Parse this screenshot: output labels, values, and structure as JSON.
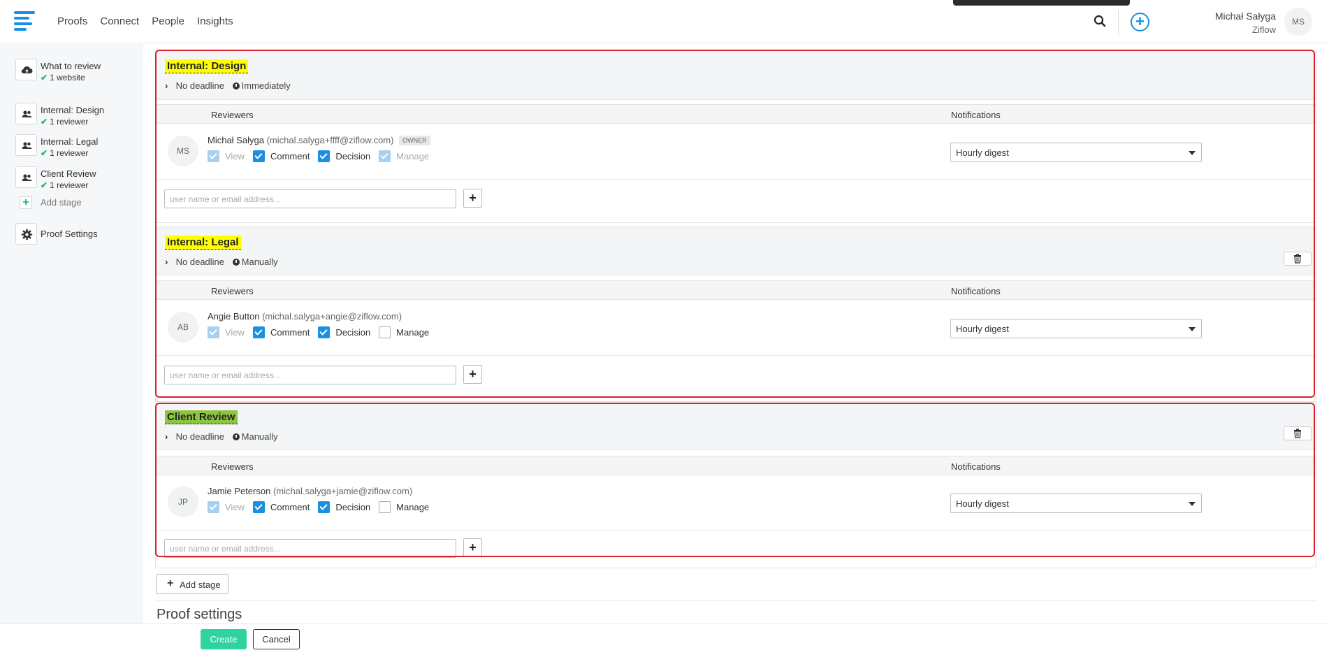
{
  "nav": {
    "items": [
      "Proofs",
      "Connect",
      "People",
      "Insights"
    ]
  },
  "user": {
    "name": "Michał Sałyga",
    "org": "Ziflow",
    "initials": "MS"
  },
  "sidebar": {
    "items": [
      {
        "title": "What to review",
        "sub": "1 website",
        "icon": "cloud-upload-icon"
      },
      {
        "title": "Internal: Design",
        "sub": "1 reviewer",
        "icon": "people-icon"
      },
      {
        "title": "Internal: Legal",
        "sub": "1 reviewer",
        "icon": "people-icon"
      },
      {
        "title": "Client Review",
        "sub": "1 reviewer",
        "icon": "people-icon"
      }
    ],
    "add_stage": "Add stage",
    "proof_settings": "Proof Settings"
  },
  "columns": {
    "reviewers": "Reviewers",
    "notifications": "Notifications"
  },
  "permissions": {
    "view": "View",
    "comment": "Comment",
    "decision": "Decision",
    "manage": "Manage"
  },
  "input_placeholder": "user name or email address...",
  "stages": [
    {
      "name": "Internal: Design",
      "deadline": "No deadline",
      "start": "Immediately",
      "highlight": "#ffff00",
      "reviewer": {
        "initials": "MS",
        "name": "Michał Sałyga",
        "email": "(michal.salyga+ffff@ziflow.com)",
        "badge": "OWNER",
        "notification": "Hourly digest"
      }
    },
    {
      "name": "Internal: Legal",
      "deadline": "No deadline",
      "start": "Manually",
      "highlight": "#ffff00",
      "reviewer": {
        "initials": "AB",
        "name": "Angie Button",
        "email": "(michal.salyga+angie@ziflow.com)",
        "notification": "Hourly digest"
      }
    },
    {
      "name": "Client Review",
      "deadline": "No deadline",
      "start": "Manually",
      "highlight": "#8cc63f",
      "reviewer": {
        "initials": "JP",
        "name": "Jamie Peterson",
        "email": "(michal.salyga+jamie@ziflow.com)",
        "notification": "Hourly digest"
      }
    }
  ],
  "add_stage_button": "Add stage",
  "proof_settings_title": "Proof settings",
  "footer": {
    "create": "Create",
    "cancel": "Cancel"
  },
  "colors": {
    "accent": "#1a8fe3",
    "success": "#2ab27b",
    "create": "#2fd3a0",
    "annotation": "#d9232d"
  }
}
